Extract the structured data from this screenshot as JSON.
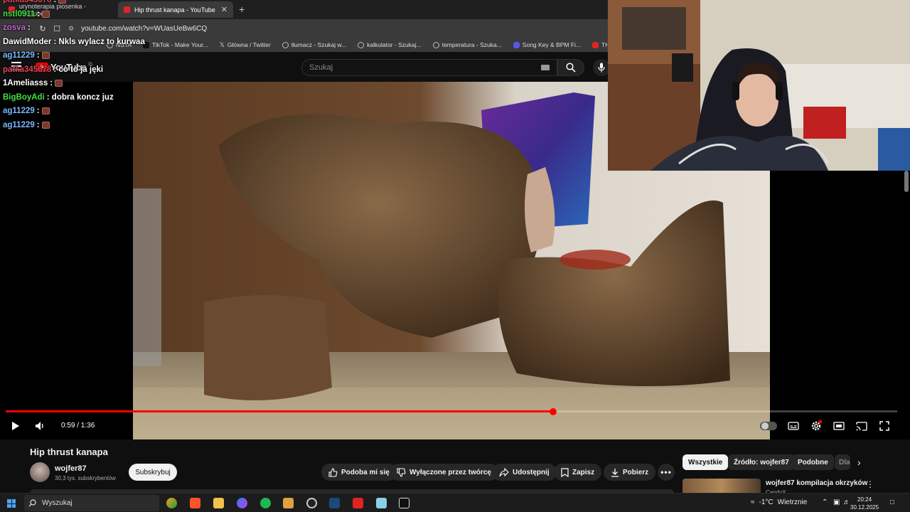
{
  "browser": {
    "tabs": [
      {
        "label": "urynoterapia piosenka - YouTube",
        "active": false
      },
      {
        "label": "Hip thrust kanapa - YouTube",
        "active": true
      }
    ],
    "url": "youtube.com/watch?v=WUasUeBw6CQ",
    "bookmarks": [
      {
        "label": "NSTA",
        "icon": "folder-icon"
      },
      {
        "label": "TikTok - Make Your...",
        "icon": "tiktok-icon"
      },
      {
        "label": "Główna / Twitter",
        "icon": "x-icon"
      },
      {
        "label": "tłumacz - Szukaj w...",
        "icon": "globe-icon"
      },
      {
        "label": "kalkulator - Szukaj...",
        "icon": "globe-icon"
      },
      {
        "label": "temperatura - Szuka...",
        "icon": "globe-icon"
      },
      {
        "label": "Song Key & BPM Fi...",
        "icon": "music-icon"
      },
      {
        "label": "THIS is W",
        "icon": "youtube-icon"
      }
    ]
  },
  "youtube": {
    "logo_text": "YouTube",
    "logo_region": "PL",
    "search_placeholder": "Szukaj"
  },
  "chat": [
    {
      "user": "patka345678",
      "color": "#e0455a",
      "text": ":",
      "emote": true
    },
    {
      "user": "nstl0911",
      "color": "#3fe03f",
      "text": ":",
      "emote": true
    },
    {
      "user": "zosva",
      "color": "#c86ad8",
      "text": ":",
      "emote": false
    },
    {
      "user": "DawidModer",
      "color": "#ffffff",
      "text": ": Nkls wylacz to kurwaa",
      "emote": false
    },
    {
      "user": "ag11229",
      "color": "#7cb6ff",
      "text": ":",
      "emote": true
    },
    {
      "user": "patka345678",
      "color": "#e0455a",
      "text": ": co to ja jęki",
      "emote": false
    },
    {
      "user": "1Ameliasss",
      "color": "#ffffff",
      "text": ":",
      "emote": true
    },
    {
      "user": "BigBoyAdi",
      "color": "#40e040",
      "text": ": dobra koncz juz",
      "emote": false
    },
    {
      "user": "ag11229",
      "color": "#7cb6ff",
      "text": ":",
      "emote": true
    },
    {
      "user": "ag11229",
      "color": "#7cb6ff",
      "text": ":",
      "emote": true
    }
  ],
  "player": {
    "current_time": "0:59",
    "duration": "1:36",
    "time_display": "0:59 / 1:36",
    "progress_fraction": 0.614
  },
  "video_info": {
    "title": "Hip thrust kanapa",
    "channel": "wojfer87",
    "subscribers": "30,3 tys. subskrybentów",
    "subscribe_label": "Subskrybuj",
    "actions": {
      "like": "Podoba mi się",
      "dislike": "Wyłączone przez twórcę",
      "share": "Udostępnij",
      "save": "Zapisz",
      "download": "Pobierz"
    }
  },
  "recommendations": {
    "chips": [
      "Wszystkie",
      "Źródło: wojfer87",
      "Podobne",
      "Dla"
    ],
    "first": {
      "title": "wojfer87 kompilacja okrzyków",
      "author": "CandyX"
    }
  },
  "taskbar": {
    "search_placeholder": "Wyszukaj",
    "weather": "-1°C",
    "weather_desc": "Wietrznie",
    "time": "20:24",
    "date": "30.12.2025"
  },
  "colors": {
    "accent": "#ff0000",
    "background": "#0f0f0f",
    "chip_bg": "#272727"
  }
}
